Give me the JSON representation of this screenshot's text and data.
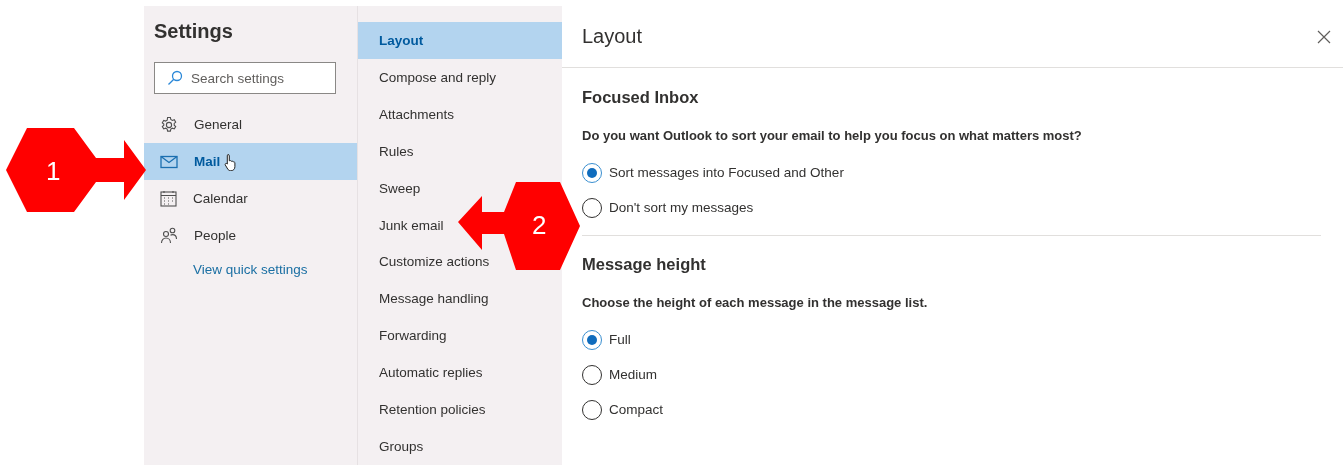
{
  "settings": {
    "title": "Settings",
    "search": {
      "placeholder": "Search settings"
    },
    "nav": [
      {
        "label": "General",
        "selected": false,
        "hover": false
      },
      {
        "label": "Mail",
        "selected": true,
        "hover": true
      },
      {
        "label": "Calendar",
        "selected": false,
        "hover": false
      },
      {
        "label": "People",
        "selected": false,
        "hover": false
      }
    ],
    "quick_link": "View quick settings"
  },
  "submenu": [
    {
      "label": "Layout",
      "selected": true
    },
    {
      "label": "Compose and reply",
      "selected": false
    },
    {
      "label": "Attachments",
      "selected": false
    },
    {
      "label": "Rules",
      "selected": false
    },
    {
      "label": "Sweep",
      "selected": false
    },
    {
      "label": "Junk email",
      "selected": false
    },
    {
      "label": "Customize actions",
      "selected": false
    },
    {
      "label": "Message handling",
      "selected": false
    },
    {
      "label": "Forwarding",
      "selected": false
    },
    {
      "label": "Automatic replies",
      "selected": false
    },
    {
      "label": "Retention policies",
      "selected": false
    },
    {
      "label": "Groups",
      "selected": false
    }
  ],
  "panel": {
    "title": "Layout",
    "sections": [
      {
        "heading": "Focused Inbox",
        "question": "Do you want Outlook to sort your email to help you focus on what matters most?",
        "options": [
          {
            "label": "Sort messages into Focused and Other",
            "selected": true
          },
          {
            "label": "Don't sort my messages",
            "selected": false
          }
        ]
      },
      {
        "heading": "Message height",
        "question": "Choose the height of each message in the message list.",
        "options": [
          {
            "label": "Full",
            "selected": true
          },
          {
            "label": "Medium",
            "selected": false
          },
          {
            "label": "Compact",
            "selected": false
          }
        ]
      }
    ]
  },
  "callouts": [
    {
      "label": "1"
    },
    {
      "label": "2"
    }
  ]
}
